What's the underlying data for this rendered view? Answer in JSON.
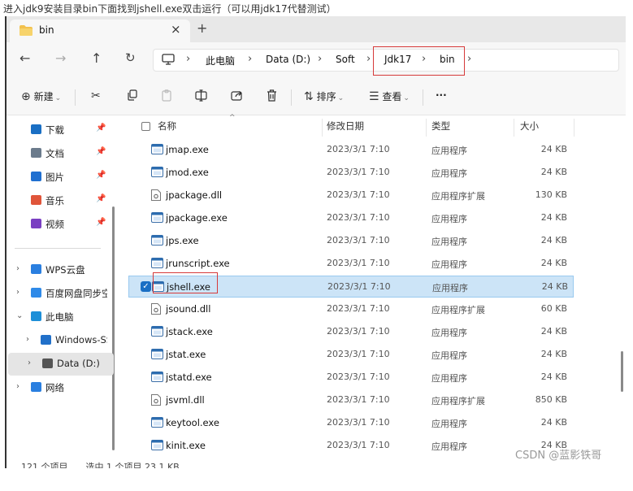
{
  "caption": "进入jdk9安装目录bin下面找到jshell.exe双击运行（可以用jdk17代替测试）",
  "tab": {
    "label": "bin",
    "close": "×",
    "new": "+"
  },
  "nav": {
    "back": "←",
    "forward": "→",
    "up": "↑",
    "refresh": "↻"
  },
  "breadcrumbs": [
    "此电脑",
    "Data (D:)",
    "Soft",
    "Jdk17",
    "bin"
  ],
  "crumb_sep": "›",
  "toolbar": {
    "new_label": "新建",
    "sort_label": "排序",
    "view_label": "查看",
    "more_label": "···"
  },
  "sidebar": {
    "quick": [
      {
        "label": "下载",
        "icon": "download-icon",
        "color": "#1a6fc4"
      },
      {
        "label": "文档",
        "icon": "document-icon",
        "color": "#6b7b8c"
      },
      {
        "label": "图片",
        "icon": "picture-icon",
        "color": "#1f6fd0"
      },
      {
        "label": "音乐",
        "icon": "music-icon",
        "color": "#e0553a"
      },
      {
        "label": "视频",
        "icon": "video-icon",
        "color": "#7a3fc2"
      }
    ],
    "tree": [
      {
        "label": "WPS云盘",
        "icon": "cloud-icon",
        "color": "#2a7fe0"
      },
      {
        "label": "百度网盘同步空",
        "icon": "baidu-icon",
        "color": "#2f8ae8"
      },
      {
        "label": "此电脑",
        "icon": "computer-icon",
        "color": "#1d8fd8"
      },
      {
        "label": "Windows-SSD",
        "icon": "windows-drive-icon",
        "color": "#2170c9"
      },
      {
        "label": "Data (D:)",
        "icon": "drive-icon",
        "color": "#555555"
      },
      {
        "label": "网络",
        "icon": "network-icon",
        "color": "#2a7fe0"
      }
    ]
  },
  "columns": {
    "name": "名称",
    "date": "修改日期",
    "type": "类型",
    "size": "大小"
  },
  "files": [
    {
      "name": "jmap.exe",
      "date": "2023/3/1 7:10",
      "type": "应用程序",
      "size": "24 KB",
      "kind": "exe"
    },
    {
      "name": "jmod.exe",
      "date": "2023/3/1 7:10",
      "type": "应用程序",
      "size": "24 KB",
      "kind": "exe"
    },
    {
      "name": "jpackage.dll",
      "date": "2023/3/1 7:10",
      "type": "应用程序扩展",
      "size": "130 KB",
      "kind": "dll"
    },
    {
      "name": "jpackage.exe",
      "date": "2023/3/1 7:10",
      "type": "应用程序",
      "size": "24 KB",
      "kind": "exe"
    },
    {
      "name": "jps.exe",
      "date": "2023/3/1 7:10",
      "type": "应用程序",
      "size": "24 KB",
      "kind": "exe"
    },
    {
      "name": "jrunscript.exe",
      "date": "2023/3/1 7:10",
      "type": "应用程序",
      "size": "24 KB",
      "kind": "exe"
    },
    {
      "name": "jshell.exe",
      "date": "2023/3/1 7:10",
      "type": "应用程序",
      "size": "24 KB",
      "kind": "exe",
      "selected": true
    },
    {
      "name": "jsound.dll",
      "date": "2023/3/1 7:10",
      "type": "应用程序扩展",
      "size": "60 KB",
      "kind": "dll"
    },
    {
      "name": "jstack.exe",
      "date": "2023/3/1 7:10",
      "type": "应用程序",
      "size": "24 KB",
      "kind": "exe"
    },
    {
      "name": "jstat.exe",
      "date": "2023/3/1 7:10",
      "type": "应用程序",
      "size": "24 KB",
      "kind": "exe"
    },
    {
      "name": "jstatd.exe",
      "date": "2023/3/1 7:10",
      "type": "应用程序",
      "size": "24 KB",
      "kind": "exe"
    },
    {
      "name": "jsvml.dll",
      "date": "2023/3/1 7:10",
      "type": "应用程序扩展",
      "size": "850 KB",
      "kind": "dll"
    },
    {
      "name": "keytool.exe",
      "date": "2023/3/1 7:10",
      "type": "应用程序",
      "size": "24 KB",
      "kind": "exe"
    },
    {
      "name": "kinit.exe",
      "date": "2023/3/1 7:10",
      "type": "应用程序",
      "size": "24 KB",
      "kind": "exe"
    }
  ],
  "status": "121 个项目　　选中 1 个项目 23.1 KB",
  "watermark": "CSDN @蓝影铁哥"
}
